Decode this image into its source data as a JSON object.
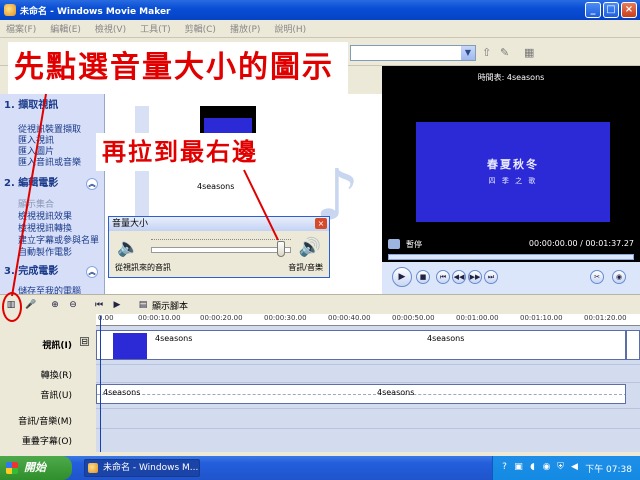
{
  "window": {
    "title": "未命名 - Windows Movie Maker"
  },
  "menu": [
    "檔案(F)",
    "編輯(E)",
    "檢視(V)",
    "工具(T)",
    "剪輯(C)",
    "播放(P)",
    "說明(H)"
  ],
  "annotations": {
    "first": "先點選音量大小的圖示",
    "second": "再拉到最右邊"
  },
  "taskpane": {
    "section1": "1. 擷取視訊",
    "section1_links": [
      "從視訊裝置擷取",
      "匯入視訊",
      "匯入圖片",
      "匯入音訊或音樂"
    ],
    "section2": "2. 編輯電影",
    "section2_links_disabled": [
      "顯示集合"
    ],
    "section2_links": [
      "檢視視訊效果",
      "檢視視訊轉換",
      "建立字幕或參與名單",
      "自動製作電影"
    ],
    "section3": "3. 完成電影",
    "section3_links": [
      "儲存至我的電腦"
    ]
  },
  "collection": {
    "clip_label": "4seasons"
  },
  "volume_dialog": {
    "title": "音量大小",
    "close": "×",
    "left_label": "從視訊來的音訊",
    "right_label": "音訊/音樂",
    "slider_value": 0.93
  },
  "monitor": {
    "title": "時間表: 4seasons",
    "screen_big": "春夏秋冬",
    "screen_small": "四 季 之 歌",
    "state": "暫停",
    "time": "00:00:00.00 / 00:01:37.27"
  },
  "timeline": {
    "storyboard_label": "顯示腳本",
    "ruler": [
      "0.00",
      "00:00:10.00",
      "00:00:20.00",
      "00:00:30.00",
      "00:00:40.00",
      "00:00:50.00",
      "00:01:00.00",
      "00:01:10.00",
      "00:01:20.00"
    ],
    "tracks": [
      "視訊(I)",
      "轉換(R)",
      "音訊(U)",
      "音訊/音樂(M)",
      "重疊字幕(O)"
    ],
    "video_clip_1": "4seasons",
    "video_clip_2": "4seasons",
    "audio_clip_1": "4seasons",
    "audio_clip_2": "4seasons"
  },
  "taskbar": {
    "start": "開始",
    "window": "未命名 - Windows M...",
    "clock": "下午 07:38"
  }
}
